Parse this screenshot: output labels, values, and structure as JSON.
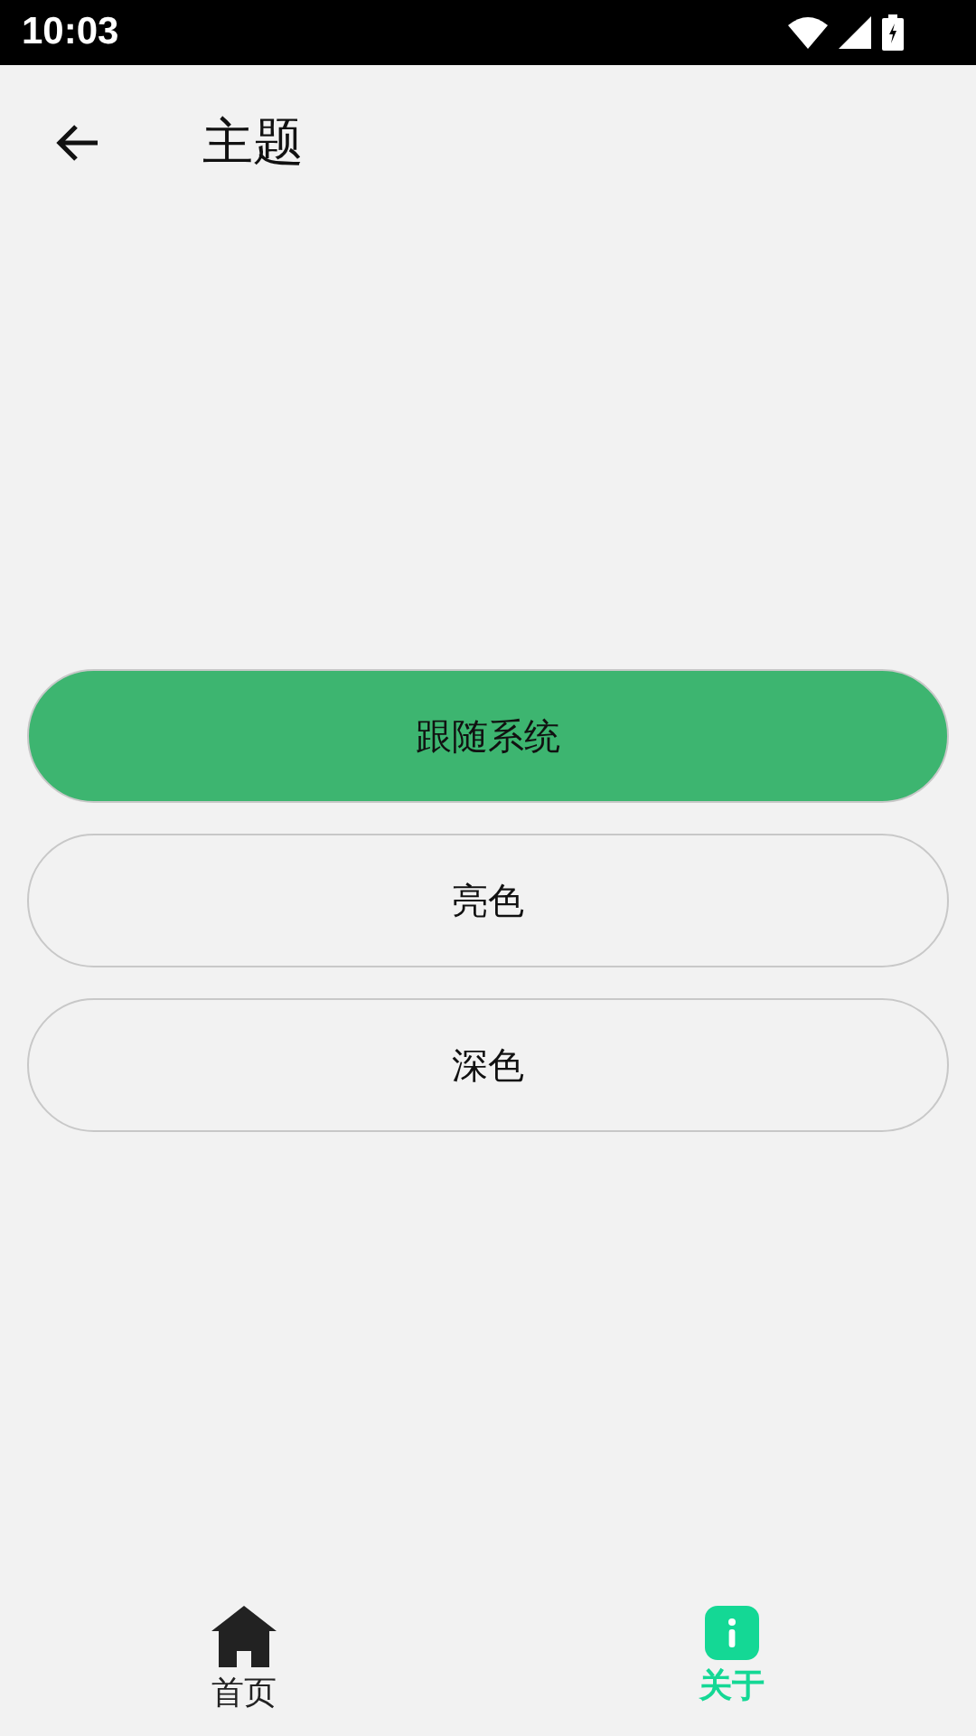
{
  "status_bar": {
    "time": "10:03"
  },
  "app_bar": {
    "title": "主题"
  },
  "options": [
    {
      "label": "跟随系统",
      "selected": true
    },
    {
      "label": "亮色",
      "selected": false
    },
    {
      "label": "深色",
      "selected": false
    }
  ],
  "bottom_nav": [
    {
      "label": "首页",
      "kind": "home",
      "selected": false
    },
    {
      "label": "关于",
      "kind": "about",
      "selected": true
    }
  ]
}
